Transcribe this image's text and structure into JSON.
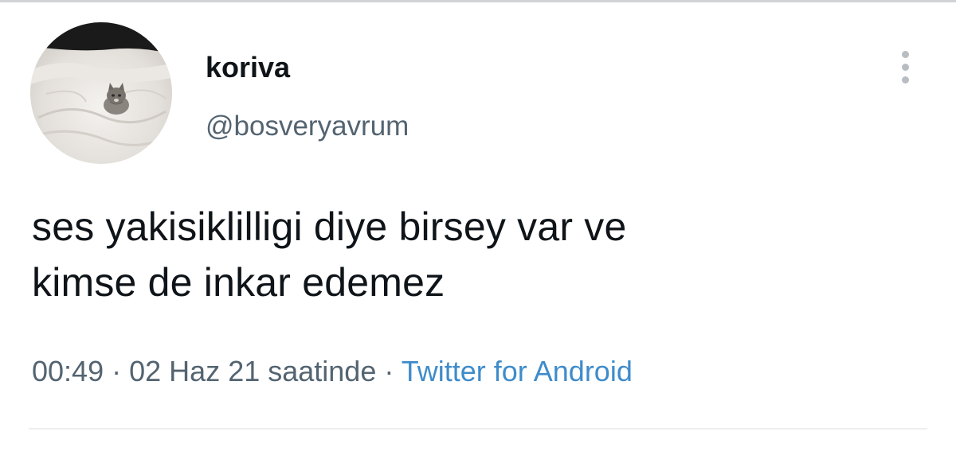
{
  "tweet": {
    "display_name": "koriva",
    "handle": "@bosveryavrum",
    "text_lines": [
      "ses yakisiklilligi diye birsey var ve",
      "kimse de inkar edemez"
    ],
    "time": "00:49",
    "date": "02 Haz 21 saatinde",
    "separator": "·",
    "source": "Twitter for Android",
    "avatar_icon": "kitten-on-bed-photo",
    "more_icon": "more-vertical-icon"
  },
  "colors": {
    "text_primary": "#0f1419",
    "text_secondary": "#536471",
    "link": "#3f8ccb",
    "background": "#ffffff"
  }
}
